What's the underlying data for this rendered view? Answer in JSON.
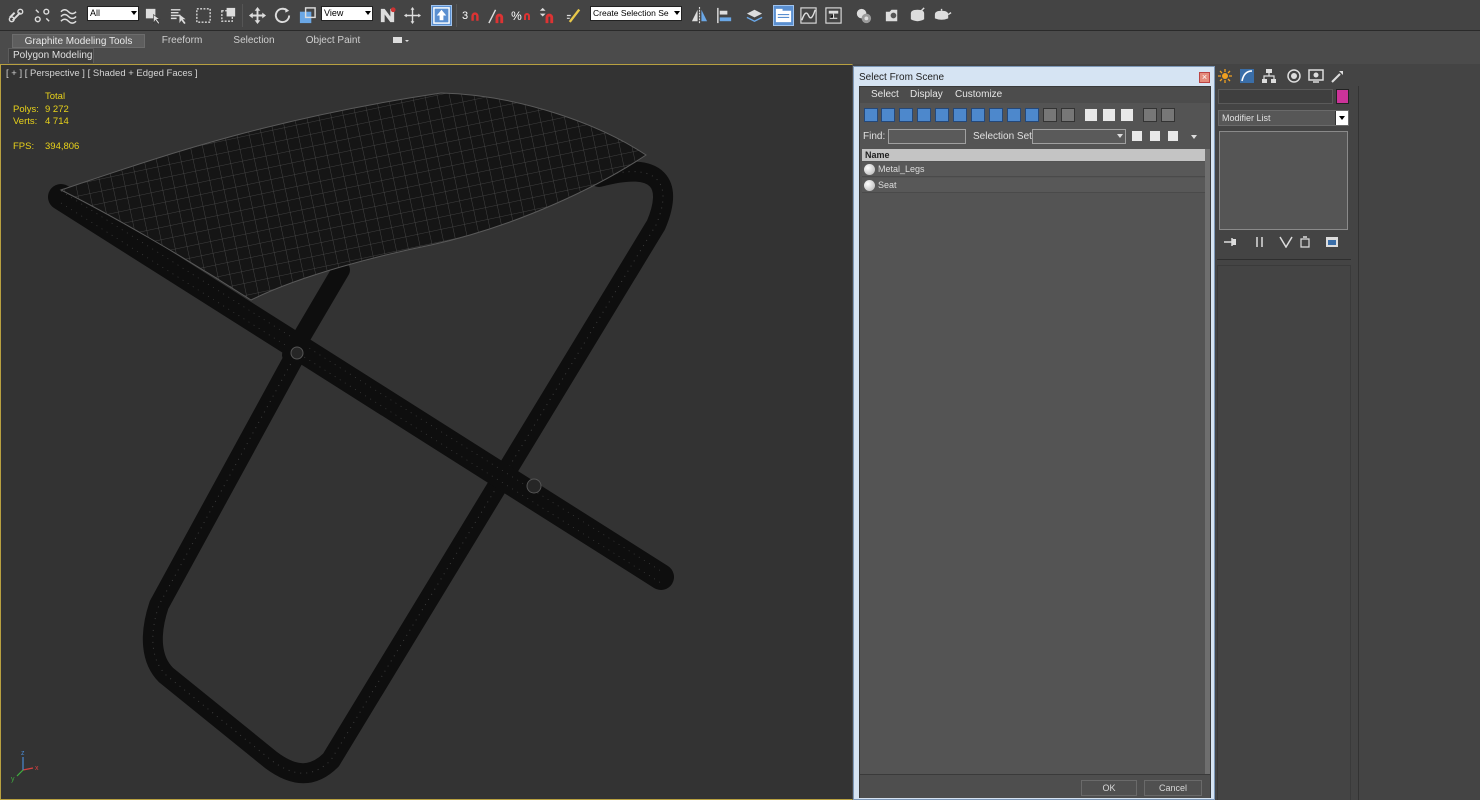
{
  "toolbar": {
    "filter_dropdown": "All",
    "ref_coord_dropdown": "View",
    "snap_label": "3",
    "percent_label": "%",
    "named_selection_dropdown": "Create Selection Se"
  },
  "ribbon": {
    "tabs": [
      "Graphite Modeling Tools",
      "Freeform",
      "Selection",
      "Object Paint"
    ],
    "panel_tab": "Polygon Modeling"
  },
  "viewport": {
    "label": "[ + ] [ Perspective ] [ Shaded + Edged Faces ]",
    "stats": {
      "header": "Total",
      "polys_label": "Polys:",
      "polys_value": "9 272",
      "verts_label": "Verts:",
      "verts_value": "4 714",
      "fps_label": "FPS:",
      "fps_value": "394,806"
    },
    "axis": {
      "x": "x",
      "y": "y",
      "z": "z"
    }
  },
  "dialog": {
    "title": "Select From Scene",
    "close_glyph": "×",
    "menu": [
      "Select",
      "Display",
      "Customize"
    ],
    "find_label": "Find:",
    "selection_set_label": "Selection Set:",
    "list_header": "Name",
    "objects": [
      "Metal_Legs",
      "Seat"
    ],
    "ok_label": "OK",
    "cancel_label": "Cancel"
  },
  "command_panel": {
    "modifier_list": "Modifier List",
    "object_color": "#cc3399"
  }
}
